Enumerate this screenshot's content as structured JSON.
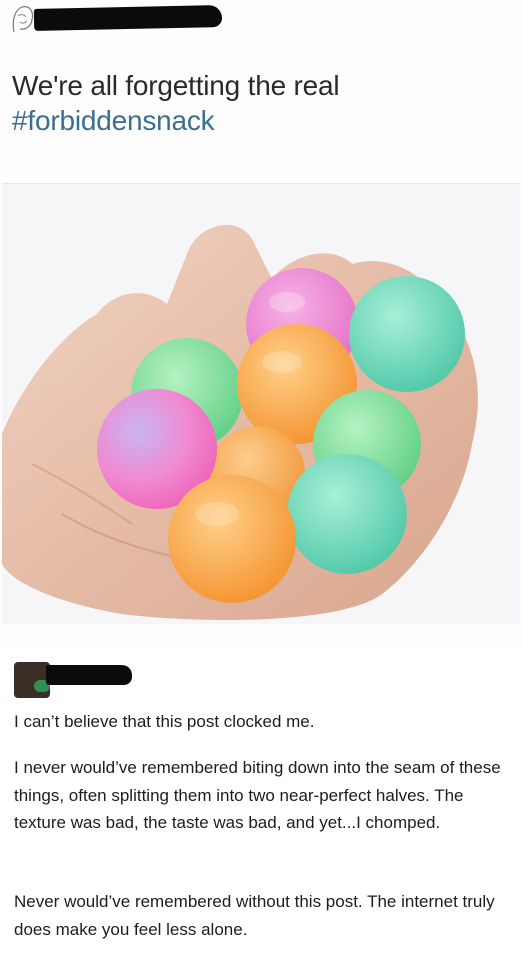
{
  "post": {
    "headline_prefix": "We're all forgetting the real",
    "hashtag": "#forbiddensnack"
  },
  "comment": {
    "paragraphs": [
      "I can’t believe that this post clocked me.",
      "I never would’ve remembered biting down into the seam of these things, often splitting them into two near-perfect halves. The texture was bad, the taste was bad, and yet...I chomped.",
      "Never would’ve remembered without this post. The internet truly does make you feel less alone."
    ]
  },
  "colors": {
    "hashtag": "#3a6f8f",
    "redaction": "#0b0b0b",
    "ball_pink": "#ef7fc9",
    "ball_orange": "#f6a24a",
    "ball_green": "#6fd89a",
    "ball_teal": "#6fd2b8"
  },
  "icons": [
    "avatar-sketch-icon",
    "commenter-avatar",
    "online-badge-icon"
  ]
}
